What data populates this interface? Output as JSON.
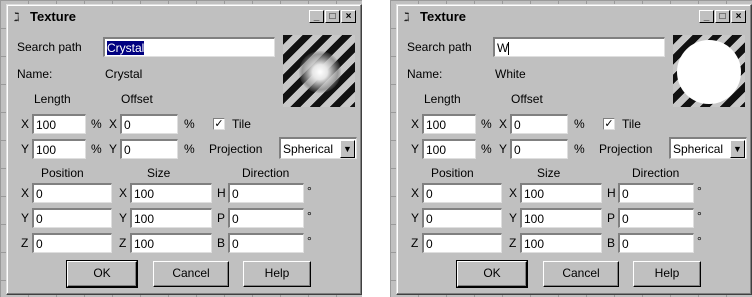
{
  "dialogs": [
    {
      "title": "Texture",
      "search_path_label": "Search path",
      "search_path_value": "Crystal",
      "name_label": "Name:",
      "name_value": "Crystal",
      "length_label": "Length",
      "offset_label": "Offset",
      "length": {
        "x": "100",
        "y": "100"
      },
      "offset": {
        "x": "0",
        "y": "0"
      },
      "tile_label": "Tile",
      "tile_checked": "✓",
      "projection_label": "Projection",
      "projection_value": "Spherical",
      "position_label": "Position",
      "size_label": "Size",
      "direction_label": "Direction",
      "position": {
        "x": "0",
        "y": "0",
        "z": "0"
      },
      "size": {
        "x": "100",
        "y": "100",
        "z": "100"
      },
      "direction": {
        "h": "0",
        "p": "0",
        "b": "0"
      },
      "ok_label": "OK",
      "cancel_label": "Cancel",
      "help_label": "Help",
      "preview": "crystal-glow-stripes"
    },
    {
      "title": "Texture",
      "search_path_label": "Search path",
      "search_path_value": "W",
      "name_label": "Name:",
      "name_value": "White",
      "length_label": "Length",
      "offset_label": "Offset",
      "length": {
        "x": "100",
        "y": "100"
      },
      "offset": {
        "x": "0",
        "y": "0"
      },
      "tile_label": "Tile",
      "tile_checked": "✓",
      "projection_label": "Projection",
      "projection_value": "Spherical",
      "position_label": "Position",
      "size_label": "Size",
      "direction_label": "Direction",
      "position": {
        "x": "0",
        "y": "0",
        "z": "0"
      },
      "size": {
        "x": "100",
        "y": "100",
        "z": "100"
      },
      "direction": {
        "h": "0",
        "p": "0",
        "b": "0"
      },
      "ok_label": "OK",
      "cancel_label": "Cancel",
      "help_label": "Help",
      "preview": "white-disc-stripes"
    }
  ],
  "common": {
    "axis_x": "X",
    "axis_y": "Y",
    "axis_z": "Z",
    "axis_h": "H",
    "axis_p": "P",
    "axis_b": "B",
    "percent": "%",
    "degree": "°",
    "minimize": "_",
    "maximize": "□",
    "close": "×",
    "dropdown_arrow": "▼",
    "title_icon": "ℷ"
  },
  "colors": {
    "dialog_face": "#c0c0c0",
    "selection": "#000080",
    "field_bg": "#ffffff"
  }
}
